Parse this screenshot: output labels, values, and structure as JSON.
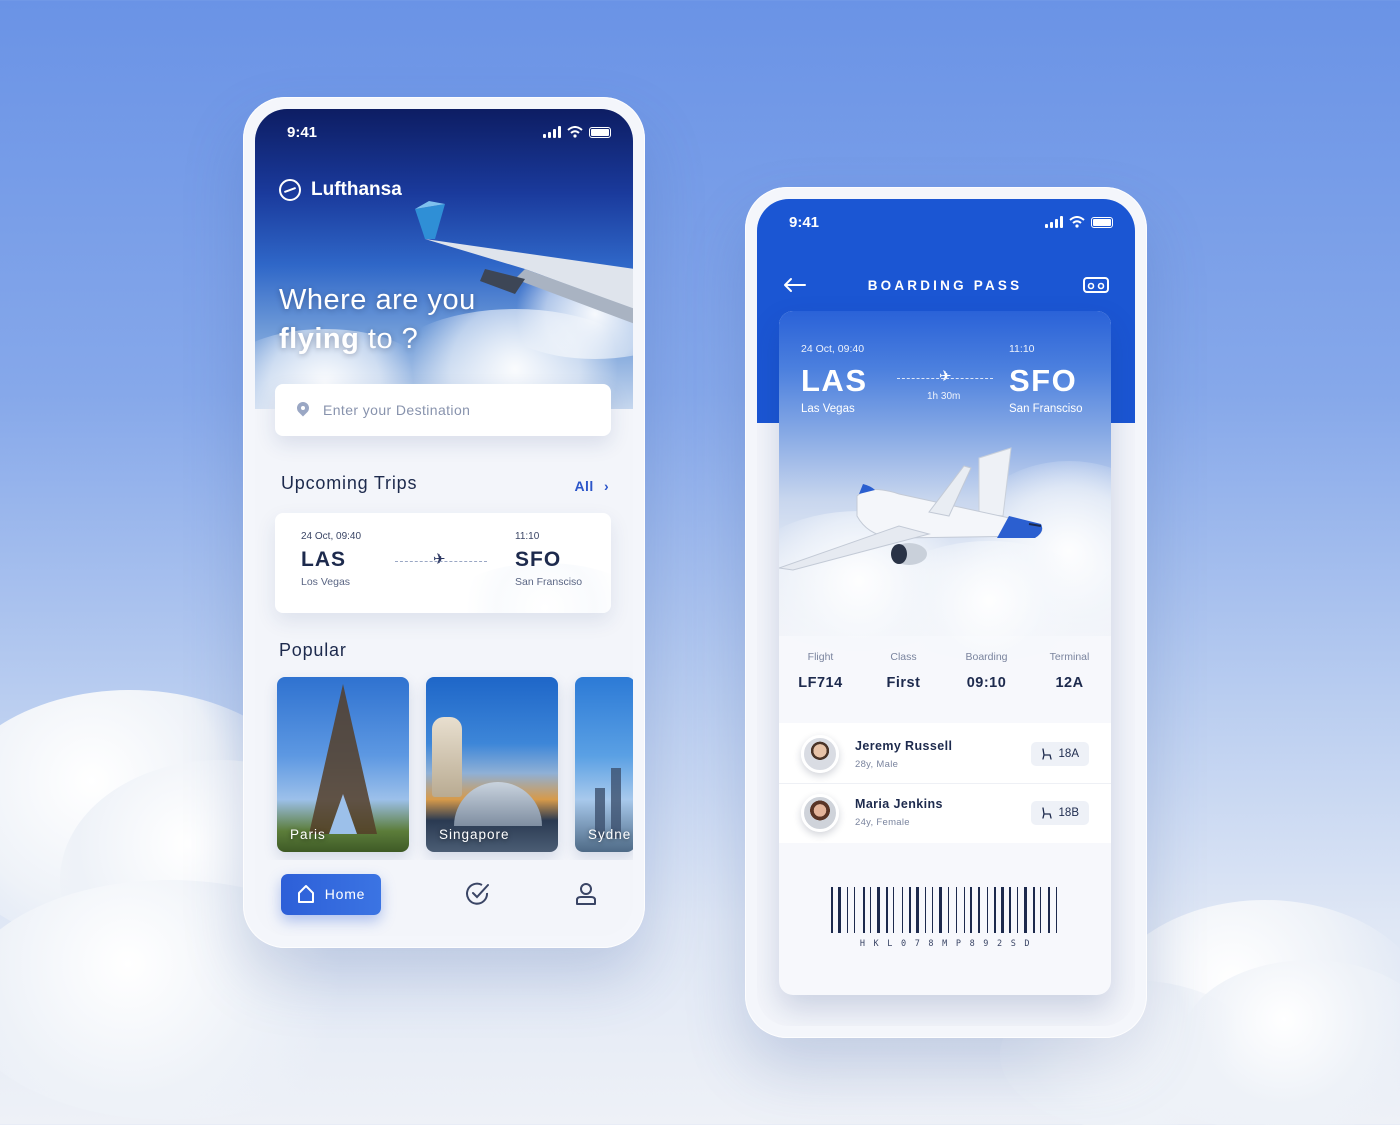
{
  "status_bar": {
    "time": "9:41"
  },
  "home": {
    "brand": "Lufthansa",
    "headline_line1": "Where are you",
    "headline_bold": "flying",
    "headline_rest": "to ?",
    "search": {
      "placeholder": "Enter your Destination"
    },
    "upcoming": {
      "title": "Upcoming Trips",
      "all_label": "All",
      "trip": {
        "depart_time": "24 Oct, 09:40",
        "from_code": "LAS",
        "from_city": "Los Vegas",
        "arrive_time": "11:10",
        "to_code": "SFO",
        "to_city": "San Fransciso"
      }
    },
    "popular": {
      "title": "Popular",
      "items": [
        {
          "label": "Paris"
        },
        {
          "label": "Singapore"
        },
        {
          "label": "Sydne"
        }
      ]
    },
    "nav": {
      "home_label": "Home"
    }
  },
  "boarding": {
    "title": "BOARDING PASS",
    "depart_time": "24 Oct, 09:40",
    "from_code": "LAS",
    "from_city": "Las Vegas",
    "arrive_time": "11:10",
    "to_code": "SFO",
    "to_city": "San Fransciso",
    "duration": "1h 30m",
    "details": [
      {
        "label": "Flight",
        "value": "LF714"
      },
      {
        "label": "Class",
        "value": "First"
      },
      {
        "label": "Boarding",
        "value": "09:10"
      },
      {
        "label": "Terminal",
        "value": "12A"
      }
    ],
    "passengers": [
      {
        "name": "Jeremy Russell",
        "info": "28y, Male",
        "seat": "18A"
      },
      {
        "name": "Maria Jenkins",
        "info": "24y, Female",
        "seat": "18B"
      }
    ],
    "barcode_text": "HKL078MP892SD"
  },
  "colors": {
    "accent": "#1b56d3",
    "button": "#2d5fd8",
    "text": "#1d2a4d"
  },
  "icons": [
    "location-pin-icon",
    "chevron-right-icon",
    "airplane-icon",
    "home-icon",
    "check-circle-icon",
    "user-icon",
    "back-arrow-icon",
    "vr-headset-icon",
    "seat-icon",
    "signal-icon",
    "wifi-icon",
    "battery-icon"
  ]
}
